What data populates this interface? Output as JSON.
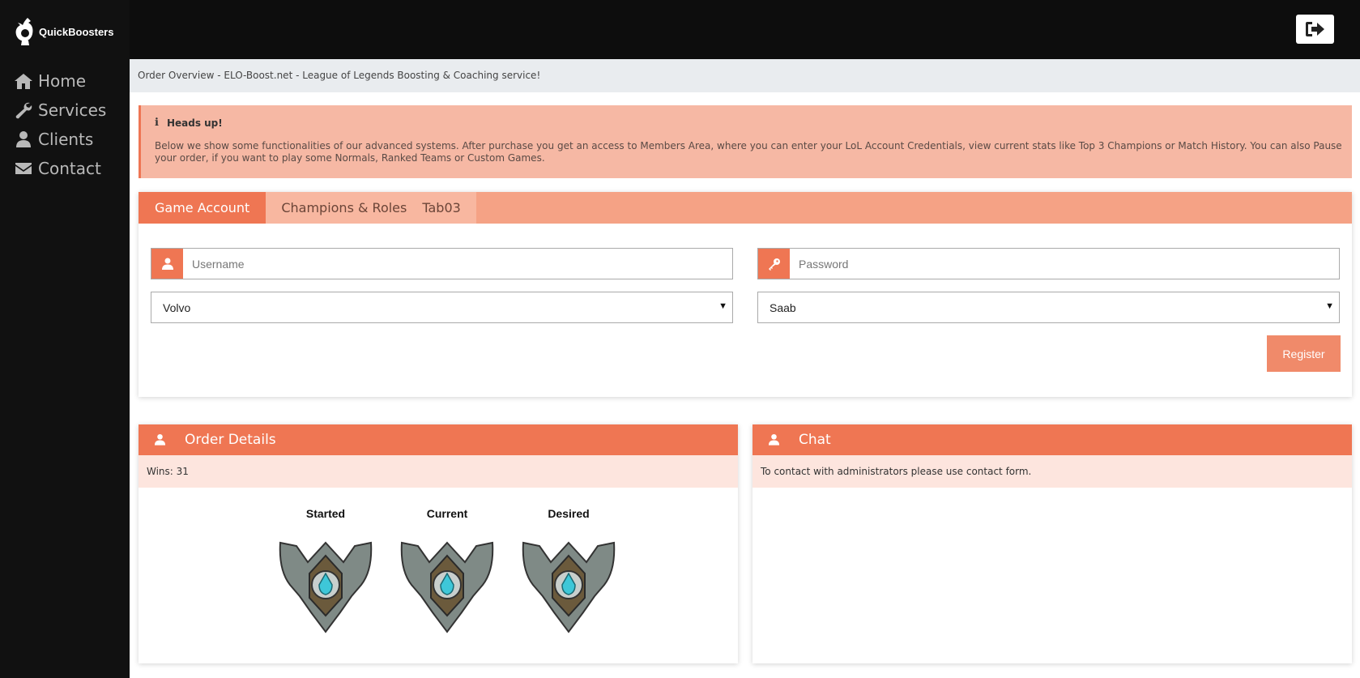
{
  "brand": {
    "name": "QuickBoosters"
  },
  "nav": {
    "items": [
      {
        "label": "Home",
        "icon": "home-icon"
      },
      {
        "label": "Services",
        "icon": "wrench-icon"
      },
      {
        "label": "Clients",
        "icon": "user-icon"
      },
      {
        "label": "Contact",
        "icon": "envelope-icon"
      }
    ]
  },
  "topbar": {
    "logout_icon": "sign-out-icon"
  },
  "breadcrumb": "Order Overview - ELO-Boost.net - League of Legends Boosting & Coaching service!",
  "alert": {
    "title": "Heads up!",
    "icon": "info-icon",
    "body": "Below we show some functionalities of our advanced systems. After purchase you get an access to Members Area, where you can enter your LoL Account Credentials, view current stats like Top 3 Champions or Match History. You can also Pause your order, if you want to play some Normals, Ranked Teams or Custom Games."
  },
  "tabs": [
    {
      "label": "Game Account",
      "active": true
    },
    {
      "label": "Champions & Roles",
      "active": false
    },
    {
      "label": "Tab03",
      "active": false
    }
  ],
  "form": {
    "username_placeholder": "Username",
    "password_placeholder": "Password",
    "select1_value": "Volvo",
    "select2_value": "Saab",
    "register_label": "Register"
  },
  "order_details": {
    "title": "Order Details",
    "wins_text": "Wins: 31",
    "ranks": [
      {
        "label": "Started"
      },
      {
        "label": "Current"
      },
      {
        "label": "Desired"
      }
    ]
  },
  "chat": {
    "title": "Chat",
    "text": "To contact with administrators please use contact form."
  },
  "colors": {
    "accent": "#ef7653",
    "sidebar_bg": "#111111",
    "alert_bg": "#f6b8a4"
  }
}
